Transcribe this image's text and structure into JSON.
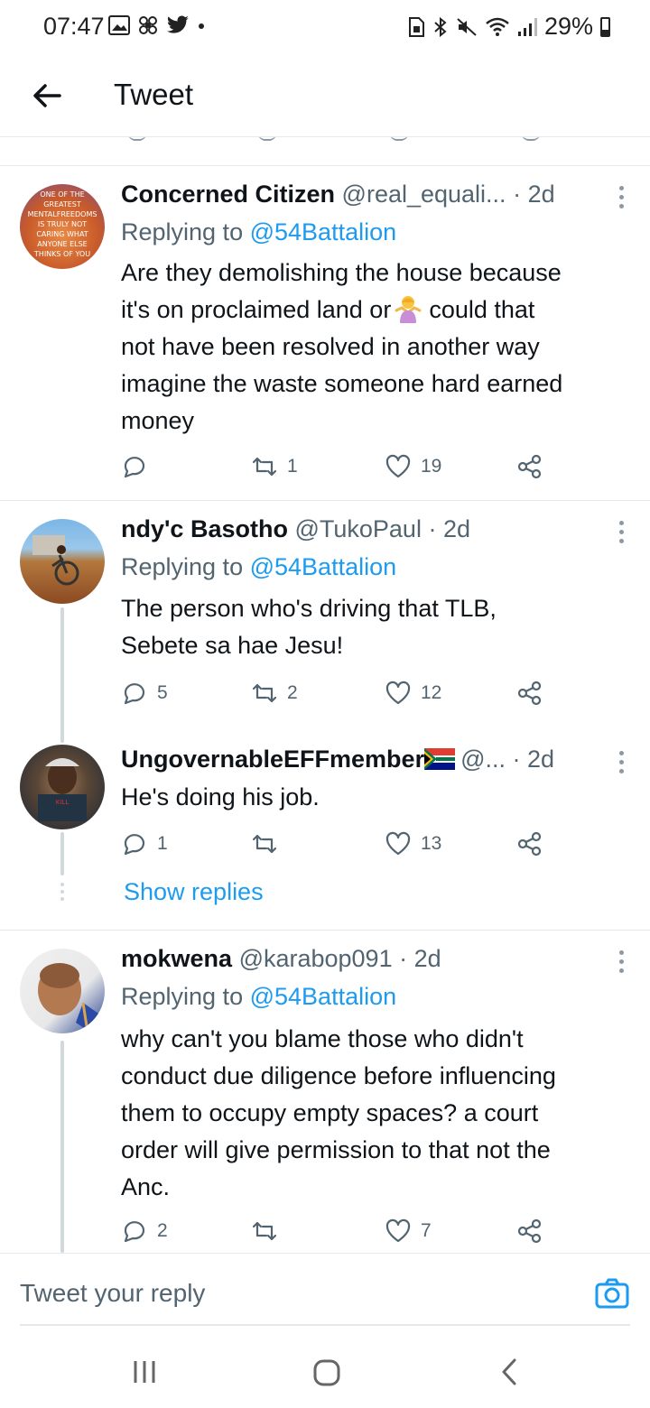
{
  "status_bar": {
    "time": "07:47",
    "battery": "29%",
    "icons": [
      "gallery-icon",
      "fan-icon",
      "twitter-bird-icon",
      "dot-icon",
      "sim-icon",
      "bluetooth-icon",
      "mute-icon",
      "wifi-icon",
      "signal-icon",
      "battery-icon"
    ]
  },
  "header": {
    "title": "Tweet",
    "back_icon": "arrow-left-icon"
  },
  "tweets": [
    {
      "name": "Concerned Citizen",
      "handle": "@real_equali...",
      "time": "· 2d",
      "reply_prefix": "Replying to",
      "reply_to": "@54Battalion",
      "text_lines": [
        "Are they demolishing the house because",
        "it's on proclaimed land or",
        "could that",
        "not have been resolved in another way",
        "imagine the waste someone hard earned",
        "money"
      ],
      "emoji_icon": "person-shrugging-icon",
      "avatar_text": [
        "ONE OF THE",
        "GREATEST",
        "MENTALFREEDOMS",
        "IS TRULY NOT",
        "CARING WHAT",
        "ANYONE ELSE",
        "THINKS OF YOU"
      ],
      "replies": "",
      "retweets": "1",
      "likes": "19"
    },
    {
      "name": "ndy'c Basotho",
      "handle": "@TukoPaul",
      "time": "· 2d",
      "reply_prefix": "Replying to",
      "reply_to": "@54Battalion",
      "text_lines": [
        "The person who's driving that TLB,",
        "Sebete sa hae Jesu!"
      ],
      "replies": "5",
      "retweets": "2",
      "likes": "12"
    },
    {
      "name": "UngovernableEFFmember",
      "handle": "@...",
      "time": "· 2d",
      "flag_icon": "south-africa-flag-icon",
      "text_lines": [
        "He's doing his job."
      ],
      "replies": "1",
      "retweets": "",
      "likes": "13",
      "show_replies": "Show replies"
    },
    {
      "name": "mokwena",
      "handle": "@karabop091",
      "time": "· 2d",
      "reply_prefix": "Replying to",
      "reply_to": "@54Battalion",
      "text_lines": [
        "why can't you blame those who didn't",
        "conduct due diligence before influencing",
        "them to occupy empty spaces? a court",
        "order will give permission to that not the",
        "Anc."
      ],
      "replies": "2",
      "retweets": "",
      "likes": "7"
    }
  ],
  "composer": {
    "placeholder": "Tweet your reply",
    "camera_icon": "camera-icon"
  },
  "navbar": {
    "icons": [
      "recent-apps-icon",
      "home-icon",
      "back-icon"
    ]
  },
  "colors": {
    "accent": "#1d9bf0",
    "text": "#0f1419",
    "secondary": "#536471",
    "divider": "#e6e9ec"
  }
}
